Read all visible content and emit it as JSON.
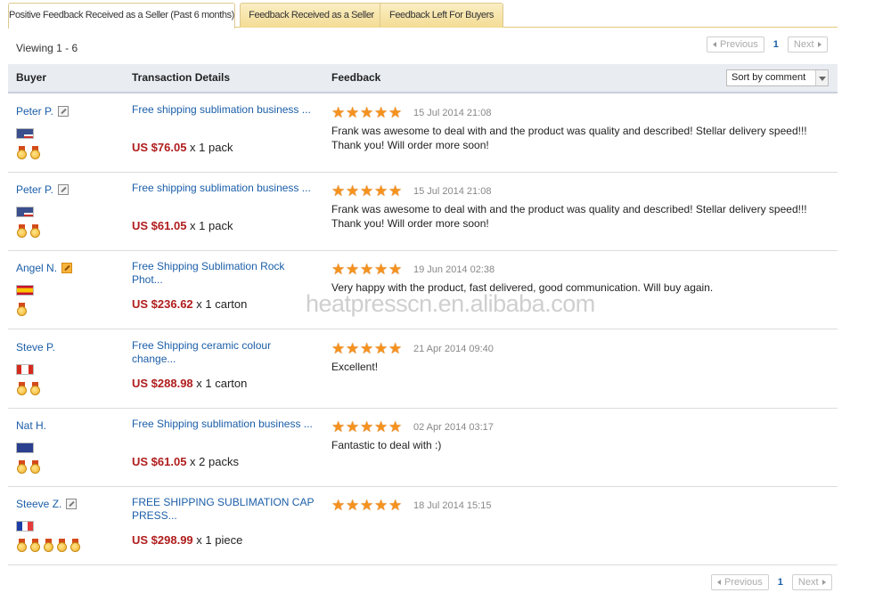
{
  "tabs": [
    {
      "label": "Positive Feedback Received as a Seller (Past 6 months)",
      "active": true
    },
    {
      "label": "Feedback Received as a Seller",
      "active": false
    },
    {
      "label": "Feedback Left For Buyers",
      "active": false
    }
  ],
  "viewing": "Viewing 1 - 6",
  "pager": {
    "previous": "Previous",
    "page": "1",
    "next": "Next"
  },
  "columns": {
    "buyer": "Buyer",
    "transaction": "Transaction Details",
    "feedback": "Feedback"
  },
  "sort": {
    "selected": "Sort by comment"
  },
  "rows": [
    {
      "buyer": "Peter P.",
      "flag": "us",
      "medals": 2,
      "product": "Free shipping sublimation business ...",
      "price": "US $76.05",
      "qty": " x 1 pack",
      "rating": 5,
      "date": "15 Jul 2014 21:08",
      "comment": "Frank was awesome to deal with and the product was quality and described! Stellar delivery speed!!! Thank you! Will order more soon!"
    },
    {
      "buyer": "Peter P.",
      "flag": "us",
      "medals": 2,
      "product": "Free shipping sublimation business ...",
      "price": "US $61.05",
      "qty": " x 1 pack",
      "rating": 5,
      "date": "15 Jul 2014 21:08",
      "comment": "Frank was awesome to deal with and the product was quality and described! Stellar delivery speed!!! Thank you! Will order more soon!"
    },
    {
      "buyer": "Angel N.",
      "flag": "es",
      "medals": 1,
      "product": "Free Shipping Sublimation Rock Phot...",
      "price": "US $236.62",
      "qty": " x 1 carton",
      "rating": 5,
      "date": "19 Jun 2014 02:38",
      "comment": "Very happy with the product, fast delivered, good communication. Will buy again."
    },
    {
      "buyer": "Steve P.",
      "flag": "ca",
      "medals": 2,
      "product": "Free Shipping ceramic colour change...",
      "price": "US $288.98",
      "qty": " x 1 carton",
      "rating": 5,
      "date": "21 Apr 2014 09:40",
      "comment": "Excellent!"
    },
    {
      "buyer": "Nat H.",
      "flag": "au",
      "medals": 2,
      "product": "Free Shipping sublimation business ...",
      "price": "US $61.05",
      "qty": " x 2 packs",
      "rating": 5,
      "date": "02 Apr 2014 03:17",
      "comment": "Fantastic to deal with :)"
    },
    {
      "buyer": "Steeve Z.",
      "flag": "fr",
      "medals": 5,
      "product": "FREE SHIPPING SUBLIMATION CAP PRESS...",
      "price": "US $298.99",
      "qty": " x 1 piece",
      "rating": 5,
      "date": "18 Jul 2014 15:15",
      "comment": ""
    }
  ],
  "watermark": "heatpresscn.en.alibaba.com",
  "colors": {
    "link": "#1b5ea8",
    "price": "#b01d1d",
    "star": "#f5921e",
    "tab": "#f3dc94"
  }
}
